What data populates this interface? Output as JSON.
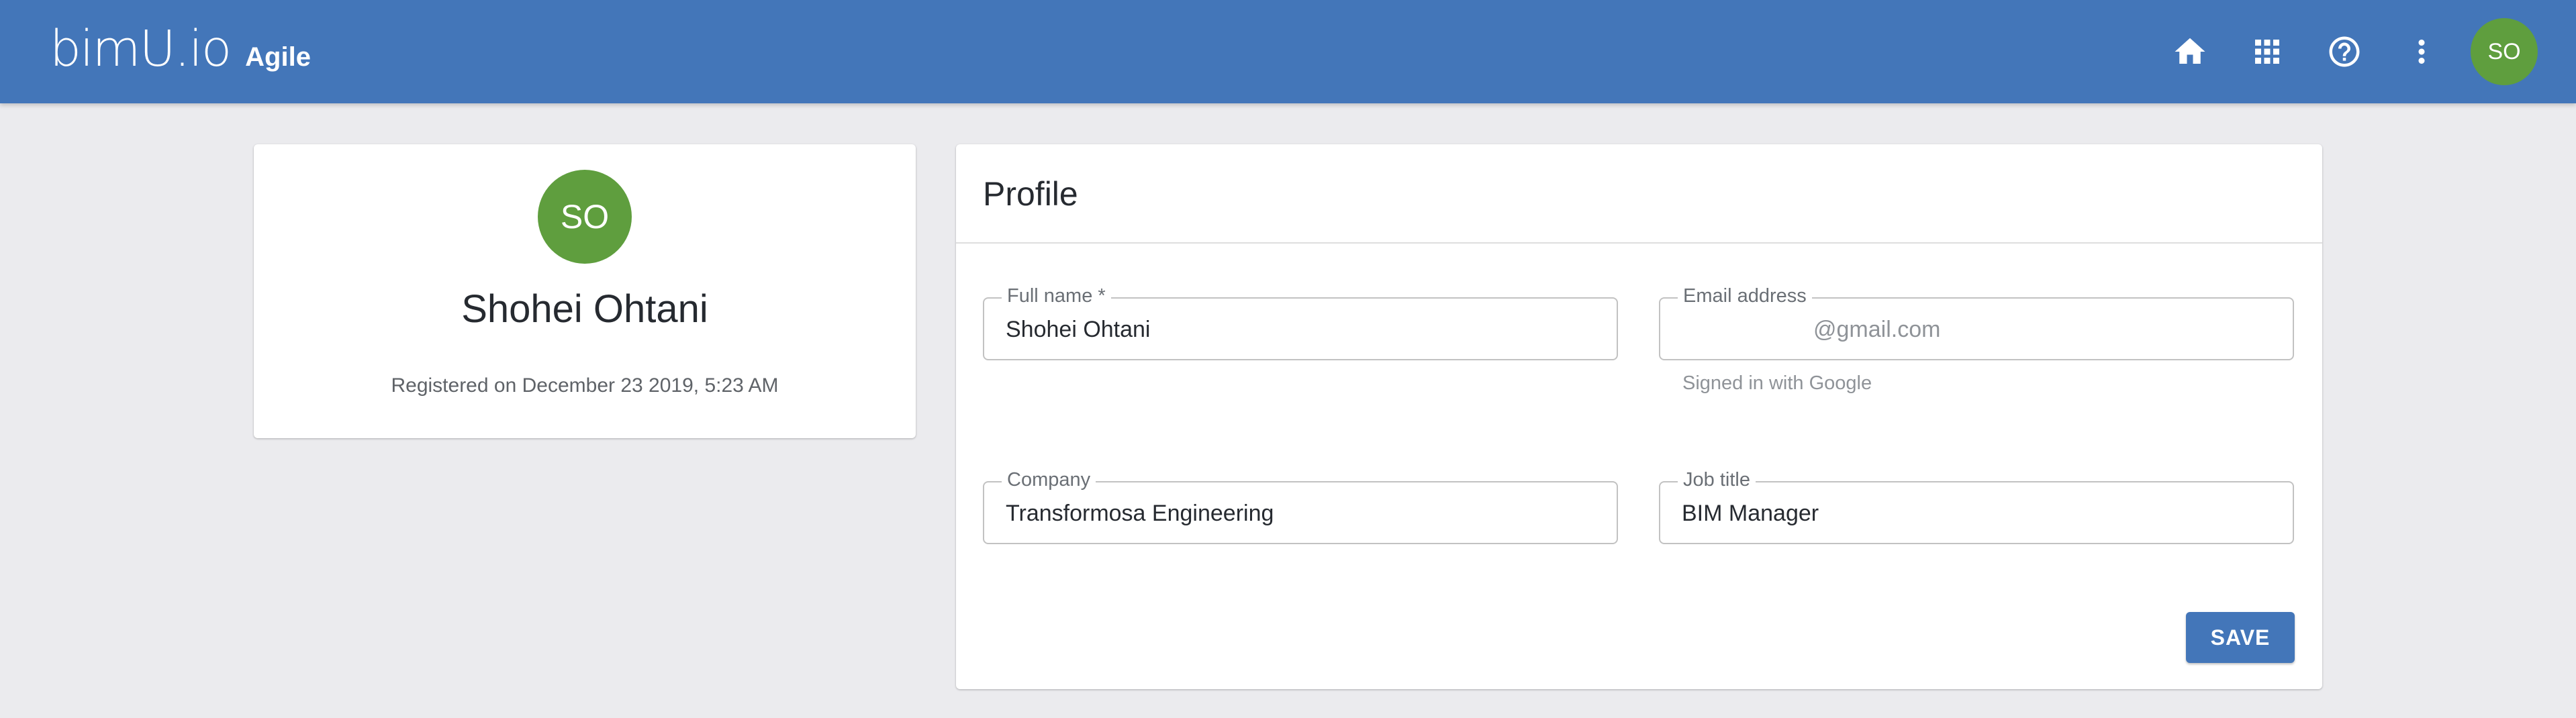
{
  "appbar": {
    "logo": "bimU.io",
    "product": "Agile",
    "icons": [
      "home-icon",
      "apps-grid-icon",
      "help-icon",
      "more-vert-icon"
    ],
    "avatar_initials": "SO",
    "color": "#4376b9"
  },
  "user_card": {
    "initials": "SO",
    "name": "Shohei Ohtani",
    "registered_label": "Registered on",
    "registered_date": "December 23 2019, 5:23 AM",
    "avatar_color": "#5f9e3e"
  },
  "profile": {
    "title": "Profile",
    "full_name": {
      "label": "Full name *",
      "value": "Shohei Ohtani"
    },
    "email": {
      "label": "Email address",
      "value": "@gmail.com",
      "helper": "Signed in with Google"
    },
    "company": {
      "label": "Company",
      "value": "Transformosa Engineering"
    },
    "job_title": {
      "label": "Job title",
      "value": "BIM Manager"
    },
    "save_label": "SAVE"
  }
}
